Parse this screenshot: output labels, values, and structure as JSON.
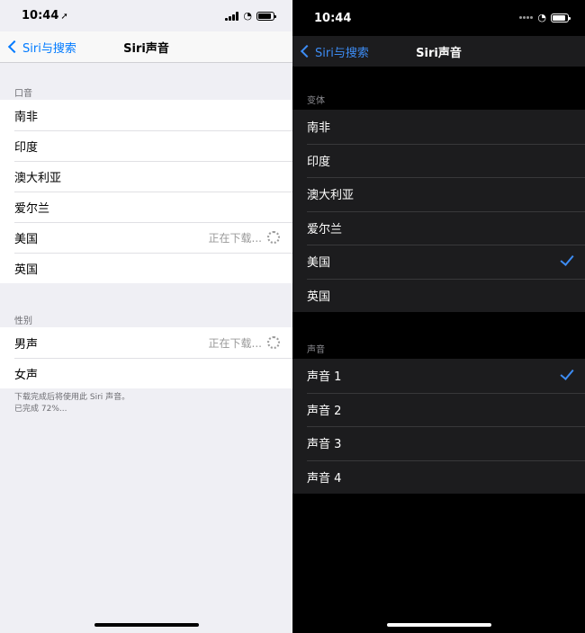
{
  "left": {
    "status": {
      "time": "10:44"
    },
    "nav": {
      "back_label": "Siri与搜索",
      "title": "Siri声音"
    },
    "accent_section": {
      "header": "口音",
      "items": [
        {
          "label": "南非"
        },
        {
          "label": "印度"
        },
        {
          "label": "澳大利亚"
        },
        {
          "label": "爱尔兰"
        },
        {
          "label": "美国",
          "status": "正在下载..."
        },
        {
          "label": "英国"
        }
      ]
    },
    "gender_section": {
      "header": "性别",
      "items": [
        {
          "label": "男声",
          "status": "正在下载..."
        },
        {
          "label": "女声"
        }
      ]
    },
    "footer": {
      "line1": "下载完成后将使用此 Siri 声音。",
      "line2": "已完成 72%..."
    }
  },
  "right": {
    "status": {
      "time": "10:44"
    },
    "nav": {
      "back_label": "Siri与搜索",
      "title": "Siri声音"
    },
    "variant_section": {
      "header": "变体",
      "items": [
        {
          "label": "南非"
        },
        {
          "label": "印度"
        },
        {
          "label": "澳大利亚"
        },
        {
          "label": "爱尔兰"
        },
        {
          "label": "美国",
          "selected": true
        },
        {
          "label": "英国"
        }
      ]
    },
    "voice_section": {
      "header": "声音",
      "items": [
        {
          "label": "声音 1",
          "selected": true
        },
        {
          "label": "声音 2"
        },
        {
          "label": "声音 3"
        },
        {
          "label": "声音 4"
        }
      ]
    }
  },
  "colors": {
    "accent": "#007aff",
    "dark_accent": "#3d8cf4"
  }
}
